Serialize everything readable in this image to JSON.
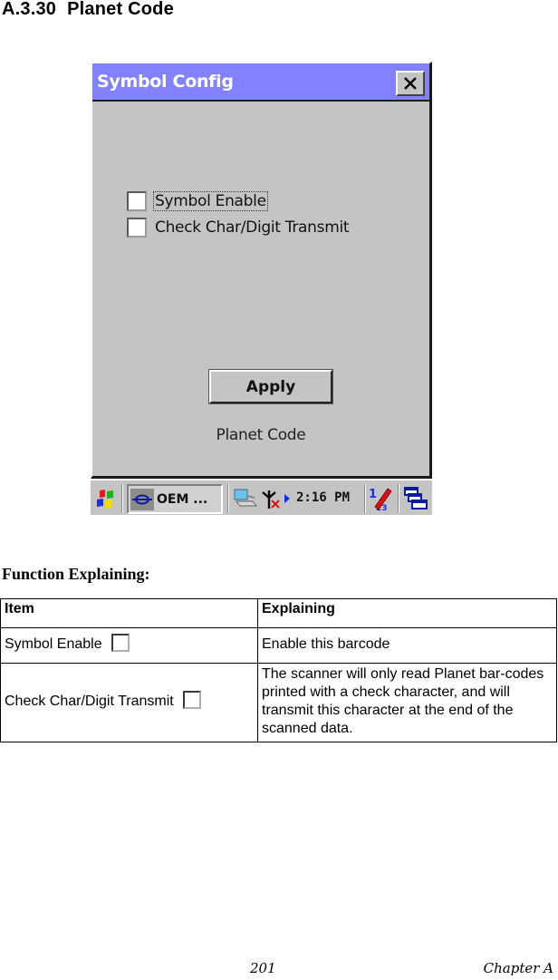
{
  "section": {
    "number": "A.3.30",
    "title": "Planet Code"
  },
  "device": {
    "window": {
      "title": "Symbol Config",
      "close_icon": "close-icon",
      "options": [
        {
          "label": "Symbol Enable",
          "checked": false,
          "focused": true
        },
        {
          "label": "Check Char/Digit Transmit",
          "checked": false,
          "focused": false
        }
      ],
      "apply_label": "Apply",
      "symbology_name": "Planet Code"
    },
    "taskbar": {
      "start_icon": "windows-start-icon",
      "task_button_label": "OEM ...",
      "task_icon": "oem-app-icon",
      "tray_icons": [
        "network-computer-icon",
        "signal-off-icon",
        "tray-expand-arrow-icon"
      ],
      "clock": "2:16 PM",
      "input_panel_icon": "input-panel-pen-icon",
      "desktop_icon": "switch-windows-icon"
    }
  },
  "function_explaining": {
    "heading": "Function Explaining:",
    "columns": [
      "Item",
      "Explaining"
    ],
    "rows": [
      {
        "item": "Symbol Enable",
        "explaining": "Enable this barcode"
      },
      {
        "item": "Check Char/Digit Transmit",
        "explaining": "The scanner will only read Planet bar-codes printed with a check character, and will transmit this character at the end of the scanned data."
      }
    ]
  },
  "footer": {
    "page_number": "201",
    "chapter": "Chapter A"
  }
}
